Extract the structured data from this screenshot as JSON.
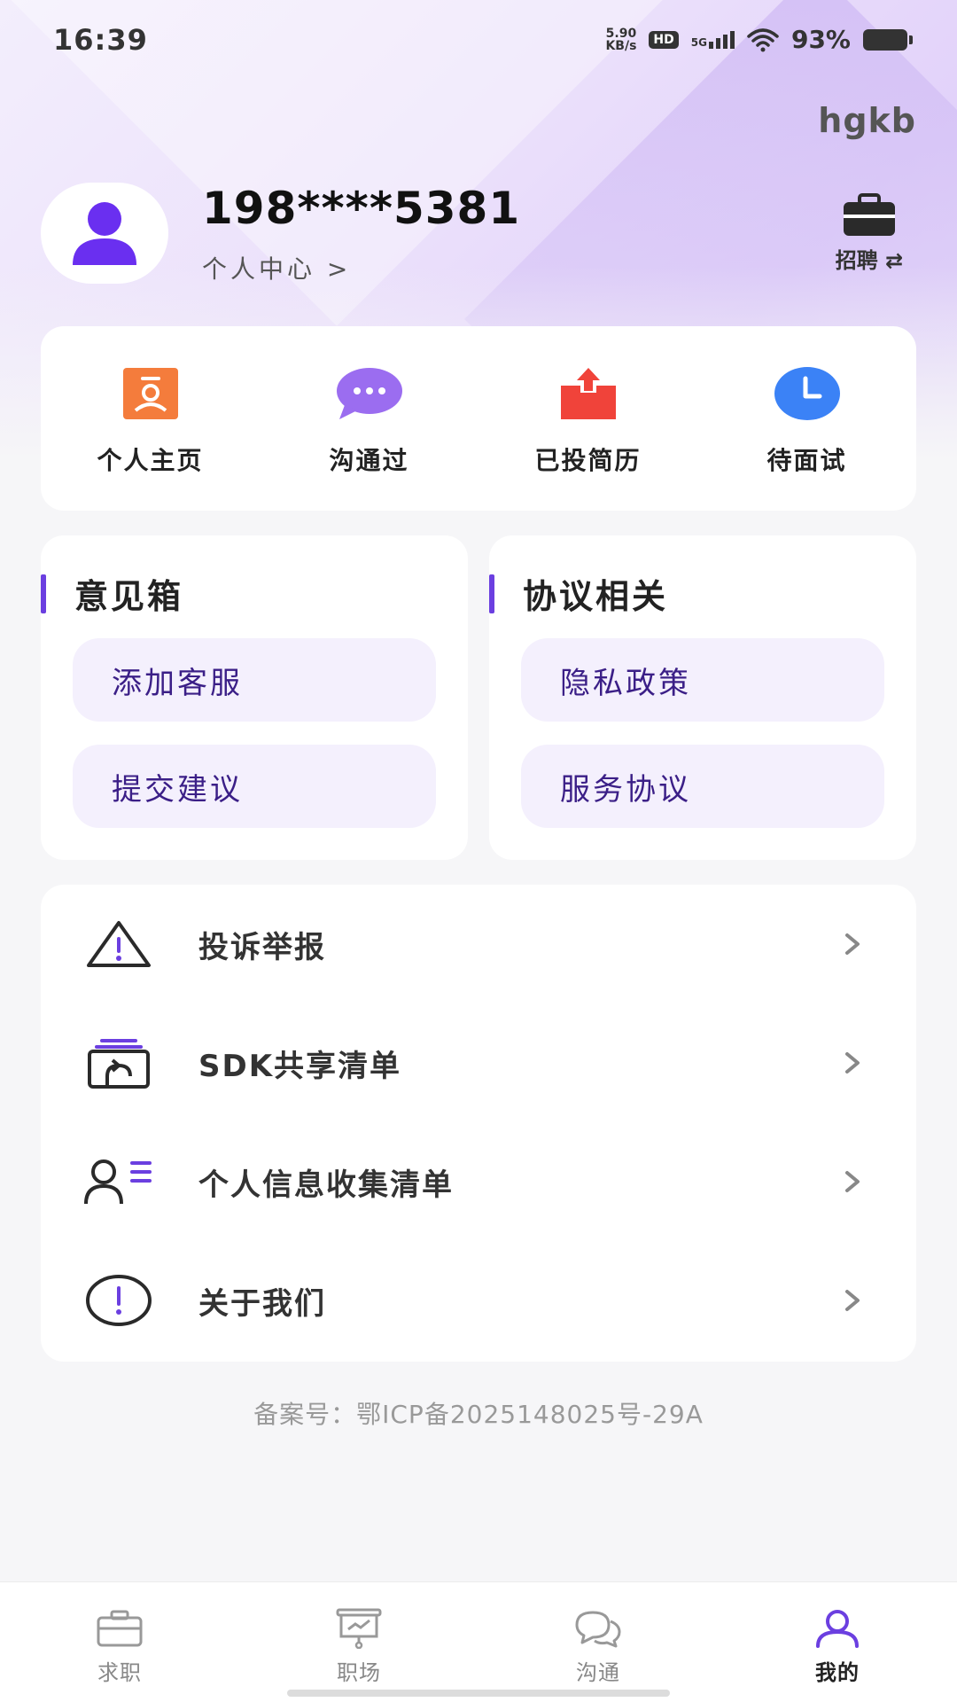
{
  "status_bar": {
    "time": "16:39",
    "net_speed_value": "5.90",
    "net_speed_unit": "KB/s",
    "hd": "HD",
    "network": "5G",
    "battery": "93%"
  },
  "brand": "hgkb",
  "profile": {
    "phone": "198****5381",
    "personal_center": "个人中心 >",
    "recruit_label": "招聘 ⇄"
  },
  "quick_actions": [
    {
      "label": "个人主页",
      "icon": "profile-card-icon"
    },
    {
      "label": "沟通过",
      "icon": "chat-bubble-icon"
    },
    {
      "label": "已投简历",
      "icon": "upload-box-icon"
    },
    {
      "label": "待面试",
      "icon": "clock-icon"
    }
  ],
  "feedback_box": {
    "title": "意见箱",
    "items": [
      "添加客服",
      "提交建议"
    ]
  },
  "agreements": {
    "title": "协议相关",
    "items": [
      "隐私政策",
      "服务协议"
    ]
  },
  "menu": [
    {
      "label": "投诉举报",
      "icon": "warning-icon"
    },
    {
      "label": "SDK共享清单",
      "icon": "share-box-icon"
    },
    {
      "label": "个人信息收集清单",
      "icon": "user-list-icon"
    },
    {
      "label": "关于我们",
      "icon": "info-circle-icon"
    }
  ],
  "icp": "备案号：鄂ICP备2025148025号-29A",
  "tabs": [
    {
      "label": "求职",
      "icon": "briefcase-icon"
    },
    {
      "label": "职场",
      "icon": "presentation-icon"
    },
    {
      "label": "沟通",
      "icon": "chat-icon"
    },
    {
      "label": "我的",
      "icon": "user-icon"
    }
  ],
  "colors": {
    "accent": "#6b3fe0",
    "pill_bg": "#f4f0fd",
    "pill_text": "#3b1f87",
    "orange": "#f47c3c",
    "chat_purple": "#9b6df0",
    "red": "#f0433a",
    "blue": "#3b82f6"
  }
}
